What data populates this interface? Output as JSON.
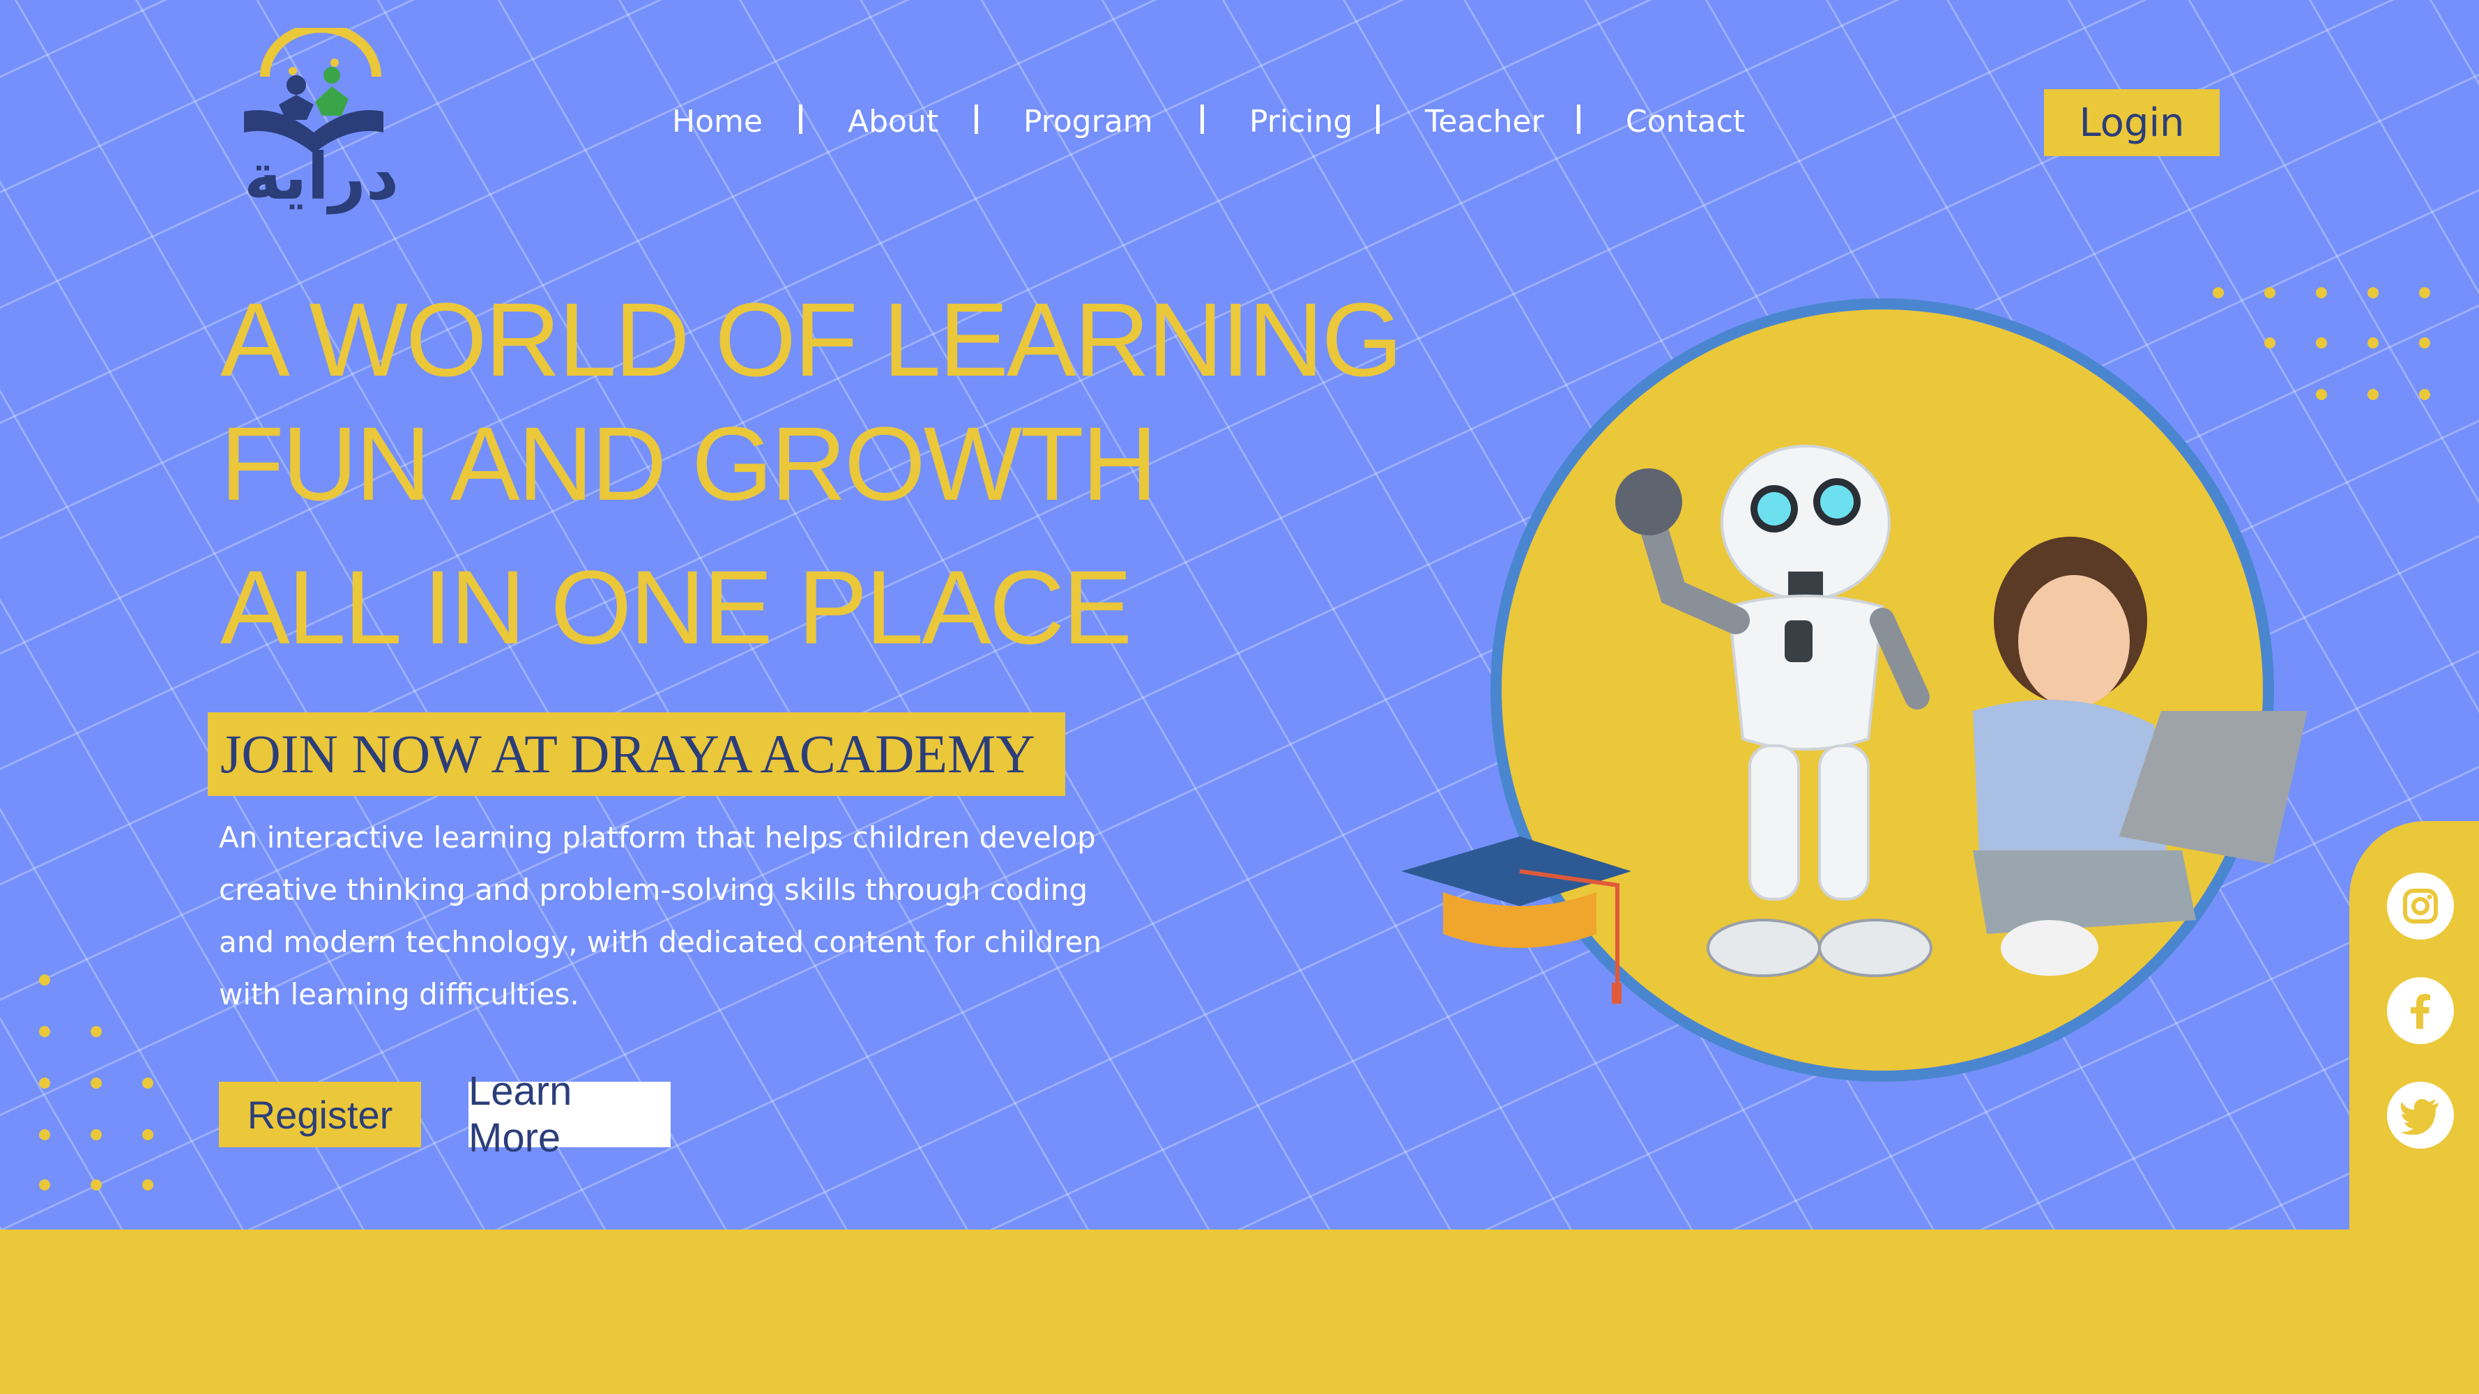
{
  "brand": {
    "logo_text": "دراية",
    "colors": {
      "background": "#7590fb",
      "accent": "#ebc73a",
      "navy": "#2b3e7a",
      "ring": "#4a86d0"
    }
  },
  "nav": {
    "items": [
      {
        "label": "Home"
      },
      {
        "label": "About"
      },
      {
        "label": "Program"
      },
      {
        "label": "Pricing"
      },
      {
        "label": "Teacher"
      },
      {
        "label": "Contact"
      }
    ],
    "login_label": "Login"
  },
  "hero": {
    "headline": [
      "A WORLD OF LEARNING",
      "FUN AND GROWTH",
      "ALL IN ONE PLACE"
    ],
    "badge": "JOIN NOW AT DRAYA ACADEMY",
    "description": [
      "An interactive learning platform that helps children develop",
      "creative thinking and problem-solving skills through coding",
      "and modern technology, with dedicated content for children",
      "with learning difficulties."
    ],
    "register_label": "Register",
    "learn_more_label": "Learn More"
  },
  "social": {
    "icons": [
      "instagram-icon",
      "facebook-icon",
      "twitter-icon"
    ]
  }
}
